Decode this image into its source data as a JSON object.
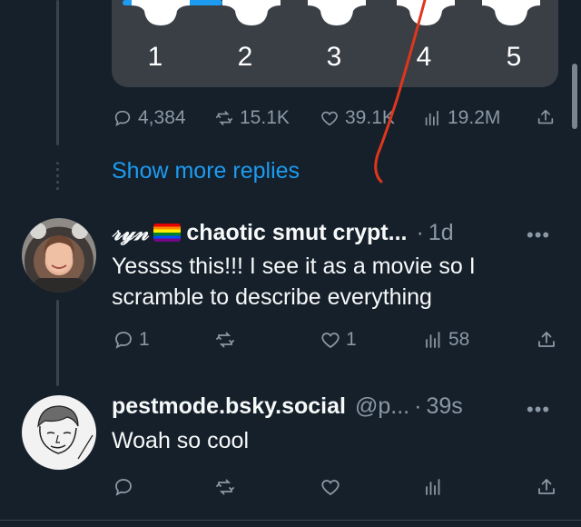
{
  "media": {
    "labels": [
      "1",
      "2",
      "3",
      "4",
      "5"
    ]
  },
  "post1_stats": {
    "replies": "4,384",
    "reposts": "15.1K",
    "likes": "39.1K",
    "views": "19.2M"
  },
  "show_more_replies": "Show more replies",
  "reply1": {
    "display_name": "𝓇𝓎𝓃 🏳️‍🌈 chaotic smut crypt...",
    "display_name_script": "𝓇𝓎𝓃",
    "display_name_rest": "chaotic smut crypt...",
    "separator": "·",
    "time": "1d",
    "text_line1": "Yessss this!!! I see it as a movie so I",
    "text_line2": "scramble to describe everything",
    "replies": "1",
    "likes": "1",
    "views": "58"
  },
  "reply2": {
    "display_name": "pestmode.bsky.social",
    "handle": "@p...",
    "separator": "·",
    "time": "39s",
    "text": "Woah so cool"
  },
  "icons": {
    "reply": "reply-icon",
    "repost": "repost-icon",
    "like": "heart-icon",
    "views": "views-icon",
    "share": "share-icon",
    "more": "more-dots-icon"
  },
  "colors": {
    "background": "#15202b",
    "accent": "#1d9bf0",
    "muted": "#8b98a5",
    "annotation": "#e0361c"
  }
}
